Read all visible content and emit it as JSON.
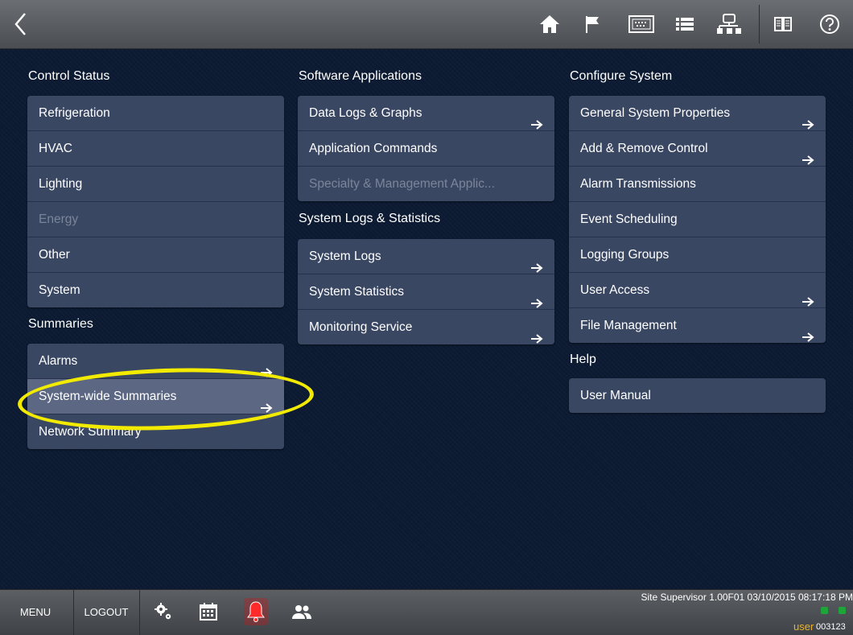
{
  "topbar": {
    "back_icon": "chevron-left-icon",
    "icons": [
      "home-icon",
      "flag-icon",
      "controller-icon",
      "list-icon",
      "network-icon",
      "book-icon",
      "help-icon"
    ]
  },
  "columns": {
    "control_status": {
      "title": "Control Status",
      "items": [
        {
          "label": "Refrigeration",
          "arrow": false,
          "disabled": false
        },
        {
          "label": "HVAC",
          "arrow": false,
          "disabled": false
        },
        {
          "label": "Lighting",
          "arrow": false,
          "disabled": false
        },
        {
          "label": "Energy",
          "arrow": false,
          "disabled": true
        },
        {
          "label": "Other",
          "arrow": false,
          "disabled": false
        },
        {
          "label": "System",
          "arrow": false,
          "disabled": false
        }
      ]
    },
    "summaries": {
      "title": "Summaries",
      "items": [
        {
          "label": "Alarms",
          "arrow": true
        },
        {
          "label": "System-wide Summaries",
          "arrow": true,
          "highlight": true
        },
        {
          "label": "Network Summary",
          "arrow": false
        }
      ]
    },
    "software_applications": {
      "title": "Software Applications",
      "items": [
        {
          "label": "Data Logs & Graphs",
          "arrow": true
        },
        {
          "label": "Application Commands",
          "arrow": false
        },
        {
          "label": "Specialty & Management Applic...",
          "arrow": false,
          "disabled": true
        }
      ]
    },
    "system_logs": {
      "title": "System Logs & Statistics",
      "items": [
        {
          "label": "System Logs",
          "arrow": true
        },
        {
          "label": "System Statistics",
          "arrow": true
        },
        {
          "label": "Monitoring Service",
          "arrow": true
        }
      ]
    },
    "configure_system": {
      "title": "Configure System",
      "items": [
        {
          "label": "General System Properties",
          "arrow": true
        },
        {
          "label": "Add & Remove Control",
          "arrow": true
        },
        {
          "label": "Alarm Transmissions",
          "arrow": false
        },
        {
          "label": "Event Scheduling",
          "arrow": false
        },
        {
          "label": "Logging Groups",
          "arrow": false
        },
        {
          "label": "User Access",
          "arrow": true
        },
        {
          "label": "File Management",
          "arrow": true
        }
      ]
    },
    "help": {
      "title": "Help",
      "items": [
        {
          "label": "User Manual",
          "arrow": false
        }
      ]
    }
  },
  "bottombar": {
    "menu_label": "MENU",
    "logout_label": "LOGOUT",
    "icons": [
      "settings-gears-icon",
      "calendar-icon",
      "alarm-bell-icon",
      "users-icon"
    ],
    "system_info": "Site Supervisor 1.00F01 03/10/2015 08:17:18 PM",
    "user_label": "user",
    "user_code": "003123"
  },
  "colors": {
    "accent_highlight": "#f2ea00",
    "panel": "#3a4763",
    "alarm": "#e31b23",
    "status_ok": "#1ea53a"
  }
}
